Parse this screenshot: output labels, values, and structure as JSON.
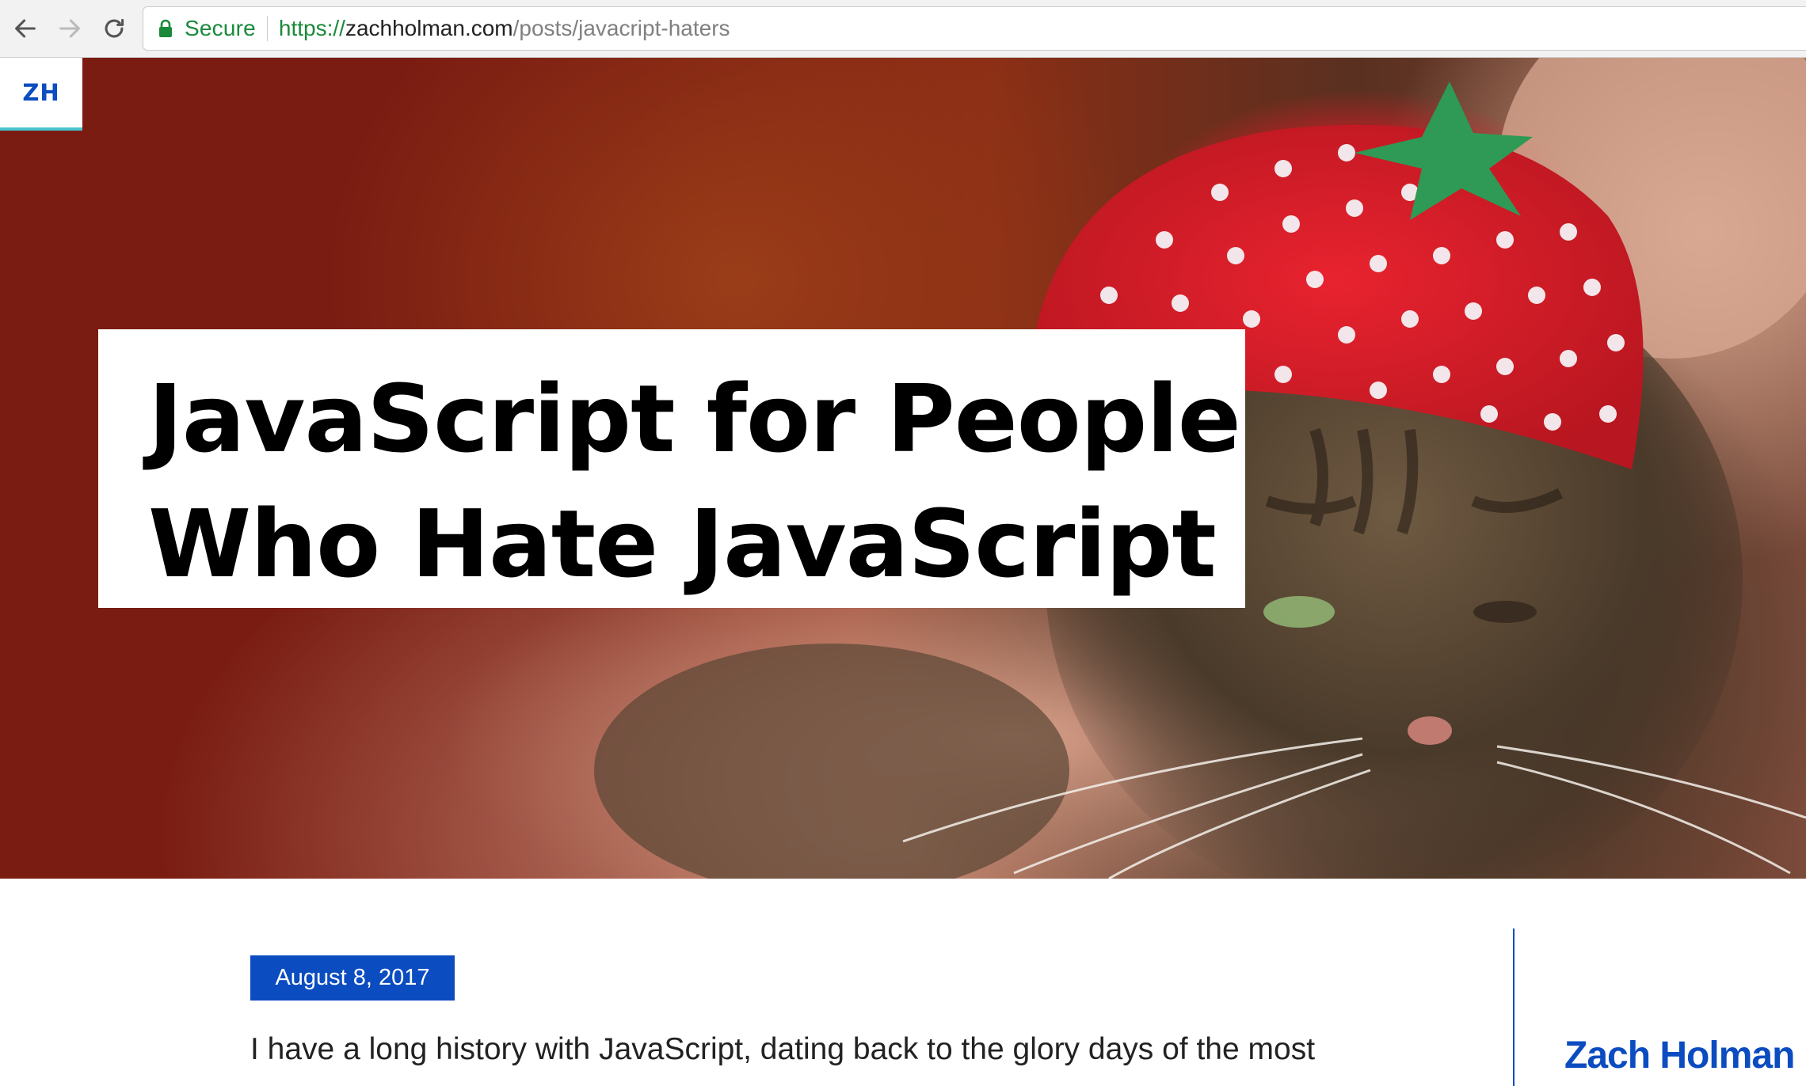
{
  "browser": {
    "secure_label": "Secure",
    "url_scheme": "https://",
    "url_host": "zachholman.com",
    "url_path": "/posts/javacript-haters"
  },
  "site": {
    "logo": "ZH"
  },
  "hero": {
    "title": "JavaScript for People Who Hate JavaScript",
    "image_subject": "cat-in-strawberry-hat"
  },
  "post": {
    "date": "August 8, 2017",
    "intro": "I have a long history with JavaScript, dating back to the glory days of the most"
  },
  "sidebar": {
    "author": "Zach Holman"
  },
  "colors": {
    "brand_blue": "#0b4cc0",
    "secure_green": "#1a8a3a",
    "logo_underline": "#49c4d0"
  },
  "icons": [
    "back-arrow-icon",
    "forward-arrow-icon",
    "reload-icon",
    "lock-icon"
  ]
}
